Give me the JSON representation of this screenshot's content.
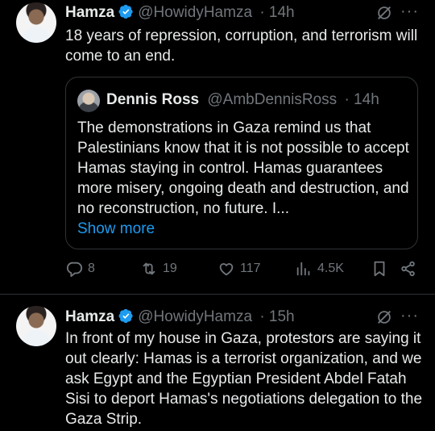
{
  "tweet1": {
    "name": "Hamza",
    "handle": "@HowidyHamza",
    "time": "· 14h",
    "more": "···",
    "text": "18 years of repression, corruption, and terrorism will come to an end.",
    "quote": {
      "name": "Dennis Ross",
      "handle": "@AmbDennisRoss",
      "time": "· 14h",
      "text": "The demonstrations in Gaza remind us that Palestinians know that it is not possible to accept Hamas staying in control. Hamas guarantees more misery, ongoing death and destruction, and no reconstruction, no future. I...",
      "show_more": "Show more"
    },
    "actions": {
      "replies": "8",
      "reposts": "19",
      "likes": "117",
      "views": "4.5K"
    }
  },
  "tweet2": {
    "name": "Hamza",
    "handle": "@HowidyHamza",
    "time": "· 15h",
    "more": "···",
    "text": "In front of my house in Gaza, protestors are saying it out clearly: Hamas is a terrorist organization, and we ask Egypt and the Egyptian President Abdel Fatah Sisi to deport Hamas's negotiations delegation to the Gaza Strip."
  },
  "colors": {
    "background": "#000000",
    "text": "#e7e9ea",
    "muted": "#71767b",
    "accent": "#1d9bf0",
    "border": "#2f3336"
  },
  "icons": [
    "verified-badge-icon",
    "grok-icon",
    "more-icon",
    "reply-icon",
    "repost-icon",
    "like-icon",
    "views-icon",
    "bookmark-icon",
    "share-icon"
  ]
}
